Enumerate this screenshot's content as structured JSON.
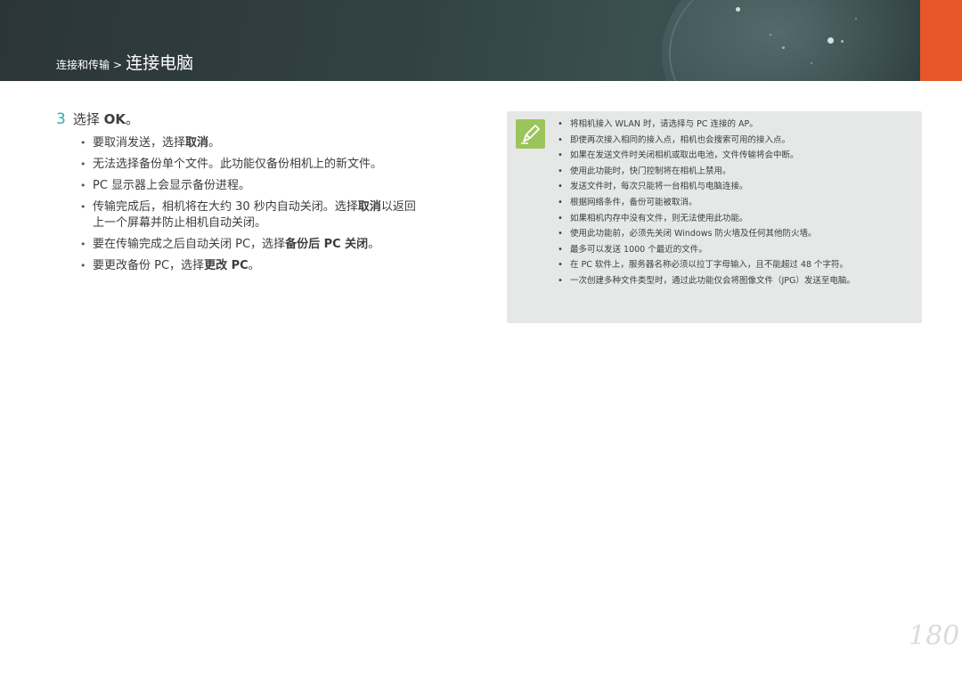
{
  "header": {
    "section": "连接和传输",
    "separator": ">",
    "title": "连接电脑"
  },
  "step": {
    "number": "3",
    "text_prefix": "选择 ",
    "text_bold": "OK",
    "text_suffix": "。"
  },
  "bullets": [
    {
      "pre": "要取消发送，选择",
      "bold": "取消",
      "post": "。"
    },
    {
      "pre": "无法选择备份单个文件。此功能仅备份相机上的新文件。",
      "bold": "",
      "post": ""
    },
    {
      "pre": "PC 显示器上会显示备份进程。",
      "bold": "",
      "post": ""
    },
    {
      "pre": "传输完成后，相机将在大约 30 秒内自动关闭。选择",
      "bold": "取消",
      "post": "以返回",
      "line2": "上一个屏幕并防止相机自动关闭。"
    },
    {
      "pre": "要在传输完成之后自动关闭 PC，选择",
      "bold": "备份后 PC 关闭",
      "post": "。"
    },
    {
      "pre": "要更改备份 PC，选择",
      "bold": "更改 PC",
      "post": "。"
    }
  ],
  "note": {
    "icon": "pen-note-icon",
    "items": [
      "将相机接入 WLAN 时，请选择与 PC 连接的 AP。",
      "即使再次接入相同的接入点，相机也会搜索可用的接入点。",
      "如果在发送文件时关闭相机或取出电池，文件传输将会中断。",
      "使用此功能时，快门控制将在相机上禁用。",
      "发送文件时，每次只能将一台相机与电脑连接。",
      "根据网络条件，备份可能被取消。",
      "如果相机内存中没有文件，则无法使用此功能。",
      "使用此功能前，必须先关闭 Windows 防火墙及任何其他防火墙。",
      "最多可以发送 1000 个最近的文件。",
      "在 PC 软件上，服务器名称必须以拉丁字母输入，且不能超过 48 个字符。",
      "一次创建多种文件类型时，通过此功能仅会将图像文件（JPG）发送至电脑。"
    ]
  },
  "page_number": "180",
  "colors": {
    "accent": "#2ea9b3",
    "orange": "#e8572a",
    "note_bg": "#e6e8e8",
    "note_icon": "#9bc45a"
  }
}
